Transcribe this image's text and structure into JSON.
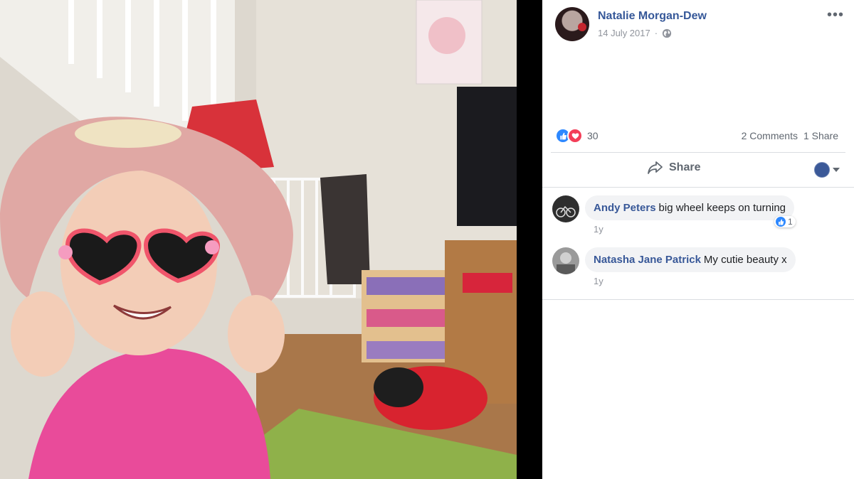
{
  "post": {
    "author": "Natalie Morgan-Dew",
    "date": "14 July 2017",
    "privacy_icon": "globe-icon",
    "more_icon": "ellipsis-icon"
  },
  "reactions": {
    "types": [
      "like",
      "love"
    ],
    "count": "30",
    "comments_label": "2 Comments",
    "shares_label": "1 Share"
  },
  "actions": {
    "share_label": "Share"
  },
  "comments": [
    {
      "name": "Andy Peters",
      "text": "big wheel keeps on turning",
      "time": "1y",
      "likes": "1"
    },
    {
      "name": "Natasha Jane Patrick",
      "text": "My cutie beauty x",
      "time": "1y"
    }
  ],
  "colors": {
    "link": "#365899",
    "like_blue": "#2d88ff",
    "love_red": "#f33e58",
    "meta_gray": "#90949c"
  }
}
